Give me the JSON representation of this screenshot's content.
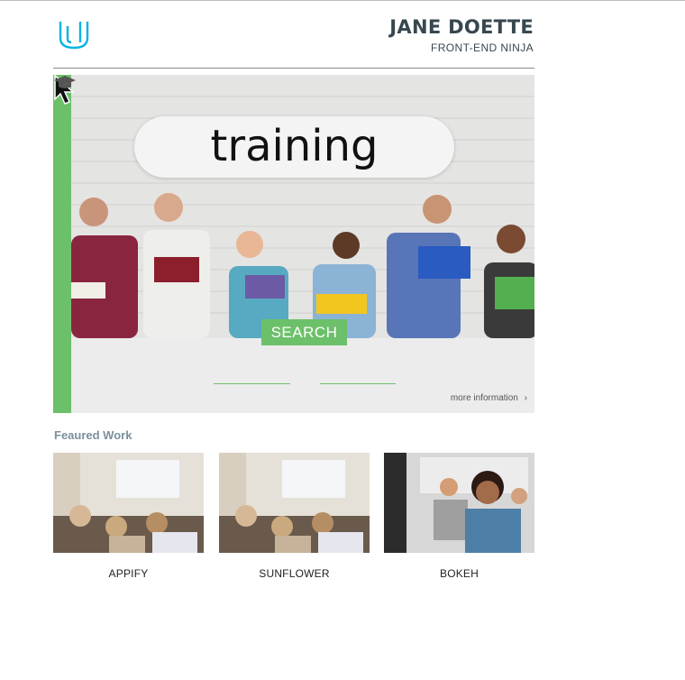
{
  "header": {
    "logo_icon": "udacity-logo-icon",
    "name": "JANE DOETTE",
    "role": "FRONT-END NINJA"
  },
  "hero": {
    "menu_icon": "hamburger-icon",
    "title": "training",
    "search_label": "SEARCH",
    "more_info_label": "more information",
    "more_info_icon": "chevron-right-icon",
    "accent_color": "#6cc06a"
  },
  "featured": {
    "title": "Feaured Work",
    "items": [
      {
        "label": "APPIFY"
      },
      {
        "label": "SUNFLOWER"
      },
      {
        "label": "BOKEH"
      }
    ]
  }
}
